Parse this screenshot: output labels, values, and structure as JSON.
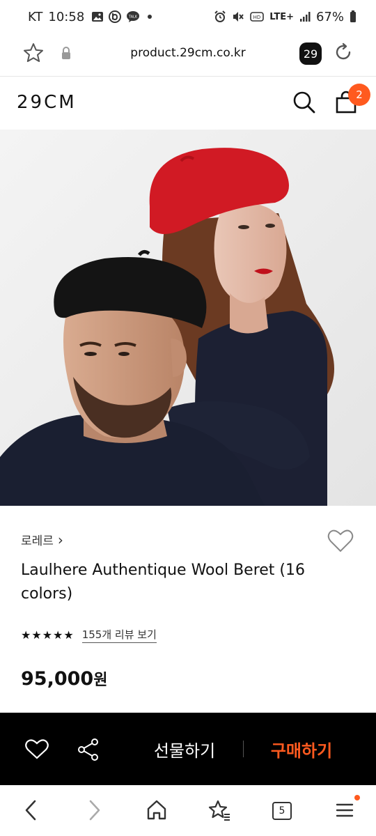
{
  "status_bar": {
    "carrier": "KT",
    "time": "10:58",
    "network": "LTE+",
    "battery": "67%"
  },
  "browser": {
    "url": "product.29cm.co.kr",
    "tab_count": "29"
  },
  "site": {
    "logo": "29CM",
    "cart_count": "2"
  },
  "product": {
    "brand": "로레르",
    "brand_chevron": "›",
    "title": "Laulhere Authentique Wool Beret (16 colors)",
    "rating_stars": 5,
    "review_link": "155개 리뷰 보기",
    "price_amount": "95,000",
    "price_unit": "원"
  },
  "actions": {
    "gift_label": "선물하기",
    "buy_label": "구매하기"
  },
  "bottom_nav": {
    "tabs_count": "5"
  },
  "colors": {
    "accent": "#ff5a1f",
    "action_bar_bg": "#000000",
    "beret_red": "#d11a24"
  }
}
